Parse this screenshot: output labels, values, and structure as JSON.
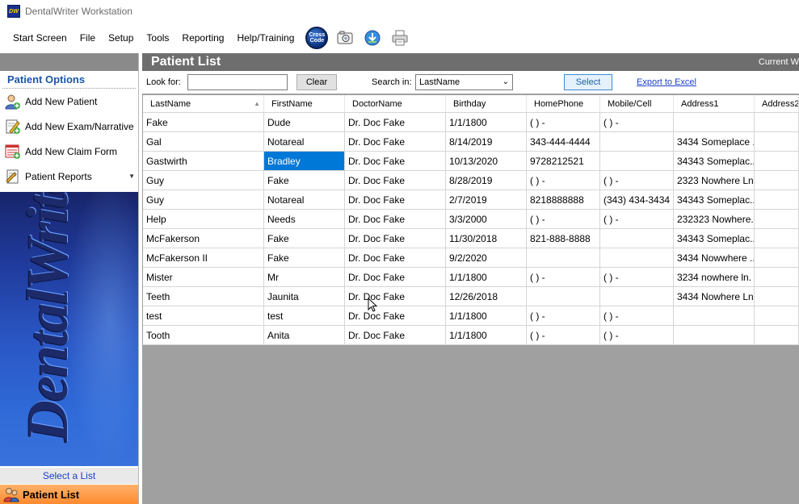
{
  "window": {
    "title": "DentalWriter Workstation",
    "app_icon_text": "DW"
  },
  "menu": {
    "items": [
      "Start Screen",
      "File",
      "Setup",
      "Tools",
      "Reporting",
      "Help/Training"
    ],
    "cross_code": [
      "Cross",
      "Code"
    ],
    "tool_icons": [
      "camera-icon",
      "download-icon",
      "printer-icon"
    ]
  },
  "left_panel": {
    "options_title": "Patient Options",
    "options": [
      {
        "label": "Add New Patient",
        "icon": "add-patient-icon"
      },
      {
        "label": "Add New Exam/Narrative",
        "icon": "exam-icon"
      },
      {
        "label": "Add New Claim Form",
        "icon": "claim-form-icon"
      },
      {
        "label": "Patient Reports",
        "icon": "reports-icon"
      }
    ],
    "banner_text": "DentalWriter",
    "select_list": "Select a List",
    "active_nav": "Patient List"
  },
  "main": {
    "title": "Patient List",
    "current_label": "Current W",
    "search": {
      "look_for_label": "Look for:",
      "look_for_value": "",
      "clear_label": "Clear",
      "search_in_label": "Search in:",
      "search_in_value": "LastName",
      "select_label": "Select",
      "export_label": "Export to Excel"
    },
    "columns": [
      "LastName",
      "FirstName",
      "DoctorName",
      "Birthday",
      "HomePhone",
      "Mobile/Cell",
      "Address1",
      "Address2"
    ],
    "rows": [
      [
        "Fake",
        "Dude",
        "Dr. Doc Fake",
        "1/1/1800",
        "(   )    -",
        "(   )    -",
        "",
        ""
      ],
      [
        "Gal",
        "Notareal",
        "Dr. Doc Fake",
        "8/14/2019",
        "343-444-4444",
        "",
        "3434 Someplace ...",
        ""
      ],
      [
        "Gastwirth",
        "Bradley",
        "Dr. Doc Fake",
        "10/13/2020",
        "9728212521",
        "",
        "34343 Someplac...",
        ""
      ],
      [
        "Guy",
        "Fake",
        "Dr. Doc Fake",
        "8/28/2019",
        "(   )    -",
        "(   )    -",
        "2323 Nowhere Ln.",
        ""
      ],
      [
        "Guy",
        "Notareal",
        "Dr. Doc Fake",
        "2/7/2019",
        "8218888888",
        "(343) 434-3434",
        "34343 Someplac...",
        ""
      ],
      [
        "Help",
        "Needs",
        "Dr. Doc Fake",
        "3/3/2000",
        "(   )    -",
        "(   )    -",
        "232323 Nowhere...",
        ""
      ],
      [
        "McFakerson",
        "Fake",
        "Dr. Doc Fake",
        "11/30/2018",
        "821-888-8888",
        "",
        "34343 Someplac...",
        ""
      ],
      [
        "McFakerson II",
        "Fake",
        "Dr. Doc Fake",
        "9/2/2020",
        "",
        "",
        "3434 Nowwhere ...",
        ""
      ],
      [
        "Mister",
        "Mr",
        "Dr. Doc Fake",
        "1/1/1800",
        "(   )    -",
        "(   )    -",
        "3234 nowhere ln.",
        ""
      ],
      [
        "Teeth",
        "Jaunita",
        "Dr. Doc Fake",
        "12/26/2018",
        "",
        "",
        "3434 Nowhere Ln.",
        ""
      ],
      [
        "test",
        "test",
        "Dr. Doc Fake",
        "1/1/1800",
        "(   )    -",
        "(   )    -",
        "",
        ""
      ],
      [
        "Tooth",
        "Anita",
        "Dr. Doc Fake",
        "1/1/1800",
        "(   )    -",
        "(   )    -",
        "",
        ""
      ]
    ],
    "selected_cell": {
      "row": 2,
      "col": 1
    }
  },
  "colors": {
    "selection": "#0078d7",
    "header_gray": "#6e6e6e",
    "nav_orange": "#ff8a2e",
    "link_blue": "#1a3fcc"
  }
}
